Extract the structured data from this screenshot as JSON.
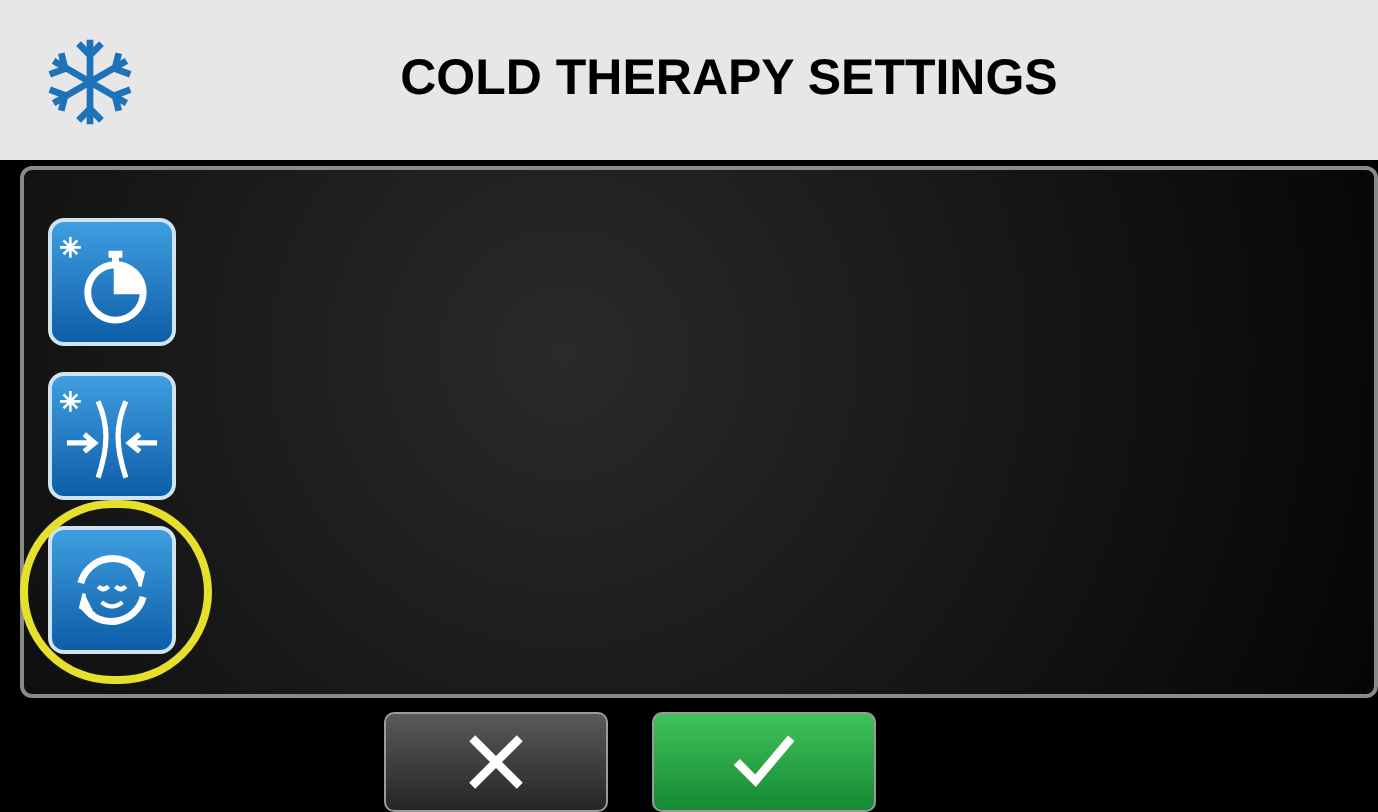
{
  "header": {
    "title": "COLD THERAPY SETTINGS"
  },
  "side_buttons": [
    {
      "kind": "timer",
      "highlighted": false
    },
    {
      "kind": "compression",
      "highlighted": false
    },
    {
      "kind": "cycle",
      "highlighted": true
    }
  ],
  "footer_buttons": [
    {
      "kind": "cancel"
    },
    {
      "kind": "confirm"
    }
  ]
}
